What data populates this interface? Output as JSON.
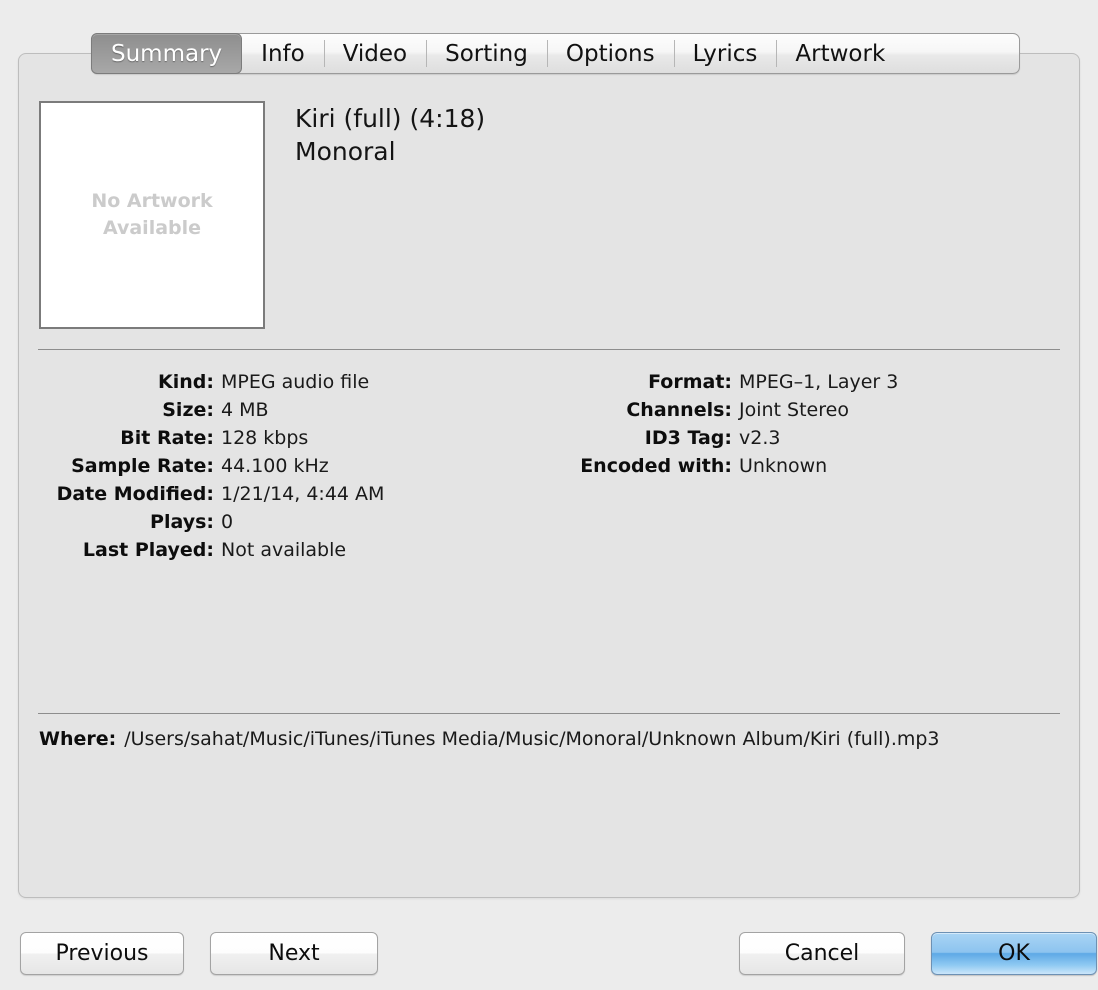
{
  "tabs": [
    {
      "label": "Summary",
      "active": true
    },
    {
      "label": "Info",
      "active": false
    },
    {
      "label": "Video",
      "active": false
    },
    {
      "label": "Sorting",
      "active": false
    },
    {
      "label": "Options",
      "active": false
    },
    {
      "label": "Lyrics",
      "active": false
    },
    {
      "label": "Artwork",
      "active": false
    }
  ],
  "artwork": {
    "placeholder_line1": "No Artwork",
    "placeholder_line2": "Available"
  },
  "track": {
    "title": "Kiri (full) (4:18)",
    "artist": "Monoral"
  },
  "details_left": [
    {
      "label": "Kind:",
      "value": "MPEG audio file"
    },
    {
      "label": "Size:",
      "value": "4 MB"
    },
    {
      "label": "Bit Rate:",
      "value": "128 kbps"
    },
    {
      "label": "Sample Rate:",
      "value": "44.100 kHz"
    },
    {
      "label": "Date Modified:",
      "value": "1/21/14, 4:44 AM"
    },
    {
      "label": "Plays:",
      "value": "0"
    },
    {
      "label": "Last Played:",
      "value": "Not available"
    }
  ],
  "details_right": [
    {
      "label": "Format:",
      "value": "MPEG–1, Layer 3"
    },
    {
      "label": "Channels:",
      "value": "Joint Stereo"
    },
    {
      "label": "ID3 Tag:",
      "value": "v2.3"
    },
    {
      "label": "Encoded with:",
      "value": "Unknown"
    }
  ],
  "where": {
    "label": "Where:",
    "value": "/Users/sahat/Music/iTunes/iTunes Media/Music/Monoral/Unknown Album/Kiri (full).mp3"
  },
  "buttons": {
    "previous": "Previous",
    "next": "Next",
    "cancel": "Cancel",
    "ok": "OK"
  },
  "colors": {
    "window_background": "#ececec",
    "panel_background": "#e4e4e4",
    "active_tab": "#9b9b9b",
    "ok_accent": "#5ea9e6",
    "divider": "#8d8d8d",
    "placeholder_text": "#cbcbcb"
  }
}
